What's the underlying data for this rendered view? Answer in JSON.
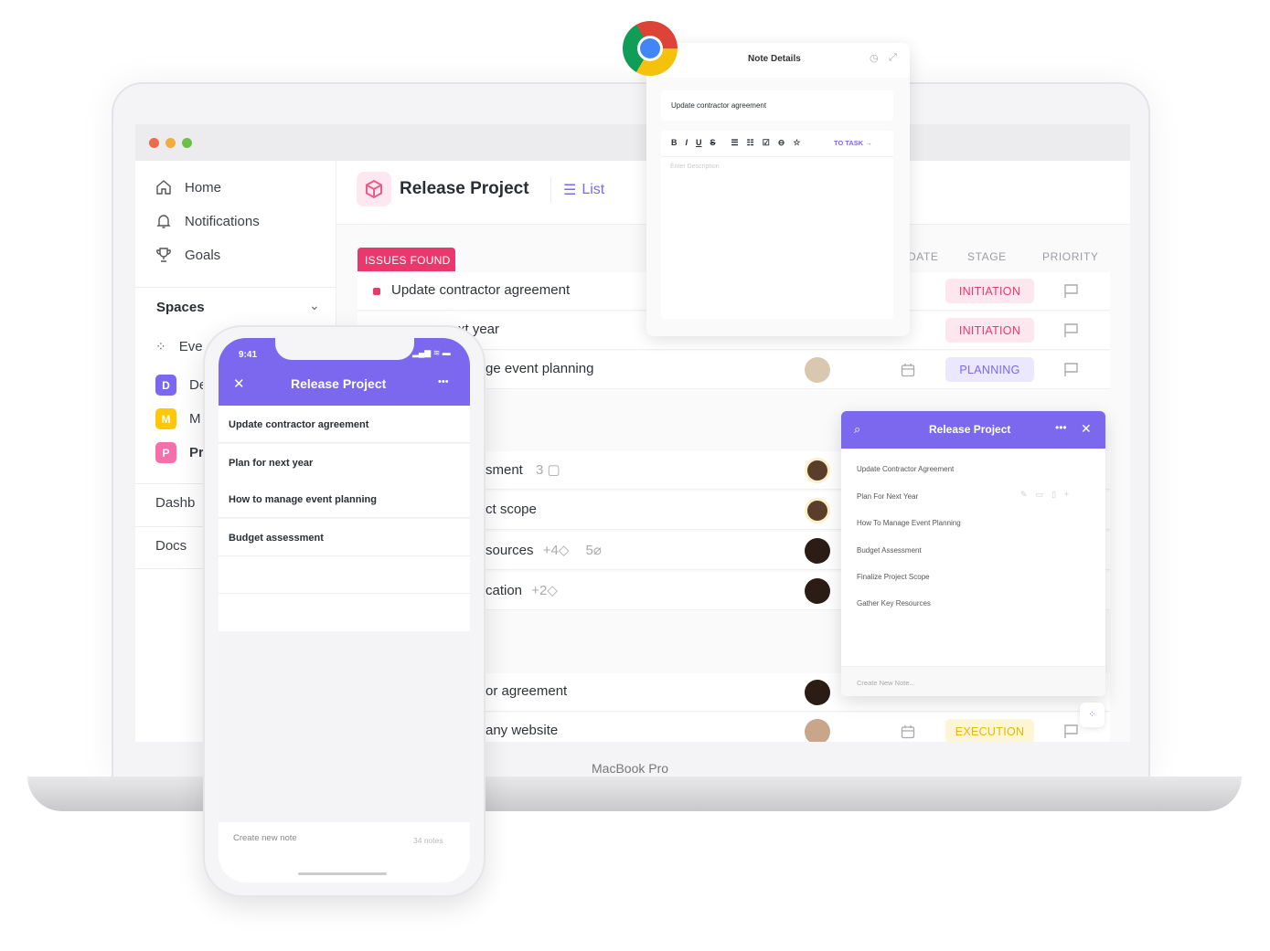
{
  "laptop": {
    "label": "MacBook Pro"
  },
  "sidebar": {
    "items": [
      {
        "label": "Home",
        "icon": "home-icon"
      },
      {
        "label": "Notifications",
        "icon": "bell-icon"
      },
      {
        "label": "Goals",
        "icon": "trophy-icon"
      }
    ],
    "spaces_label": "Spaces",
    "spaces": [
      {
        "label": "Eve",
        "icon": "grid-icon"
      },
      {
        "letter": "D",
        "label": "De",
        "color": "#7b68ee"
      },
      {
        "letter": "M",
        "label": "M",
        "color": "#ffc800"
      },
      {
        "letter": "P",
        "label": "Pr",
        "color": "#f56fab"
      }
    ],
    "bottom": [
      {
        "label": "Dashb"
      },
      {
        "label": "Docs"
      }
    ]
  },
  "header": {
    "title": "Release Project",
    "view": "List"
  },
  "table": {
    "group_label": "ISSUES FOUND",
    "columns": {
      "date": "DATE",
      "stage": "STAGE",
      "priority": "PRIORITY"
    },
    "group1": [
      {
        "name": "Update contractor agreement",
        "stage": "INITIATION"
      },
      {
        "name": "xt year",
        "stage": "INITIATION"
      },
      {
        "name": "ge event planning",
        "stage": "PLANNING"
      }
    ],
    "group2": [
      {
        "name": "sment",
        "extra": "3"
      },
      {
        "name": "ct scope",
        "extra": ""
      },
      {
        "name": "sources",
        "extra": "+4",
        "extra2": "5"
      },
      {
        "name": "cation",
        "extra": "+2"
      }
    ],
    "group3": [
      {
        "name": "or agreement",
        "stage": ""
      },
      {
        "name": "any website",
        "stage": "EXECUTION"
      }
    ]
  },
  "stage_colors": {
    "INITIATION": "#e8386d",
    "PLANNING": "#7b68ee",
    "EXECUTION": "#f2c200"
  },
  "note_details": {
    "title": "Note Details",
    "note_title": "Update contractor agreement",
    "toolbar": [
      "B",
      "I",
      "U",
      "S"
    ],
    "to_task": "TO TASK",
    "placeholder": "Enter Description"
  },
  "right_panel": {
    "title": "Release Project",
    "items": [
      "Update Contractor Agreement",
      "Plan For Next Year",
      "How To Manage Event Planning",
      "Budget Assessment",
      "Finalize Project Scope",
      "Gather Key Resources"
    ],
    "create": "Create New Note..."
  },
  "phone": {
    "time": "9:41",
    "title": "Release Project",
    "items": [
      "Update contractor agreement",
      "Plan for next year",
      "How to manage event planning",
      "Budget assessment"
    ],
    "create": "Create new note",
    "count": "34 notes"
  },
  "accent": "#7b68ee"
}
